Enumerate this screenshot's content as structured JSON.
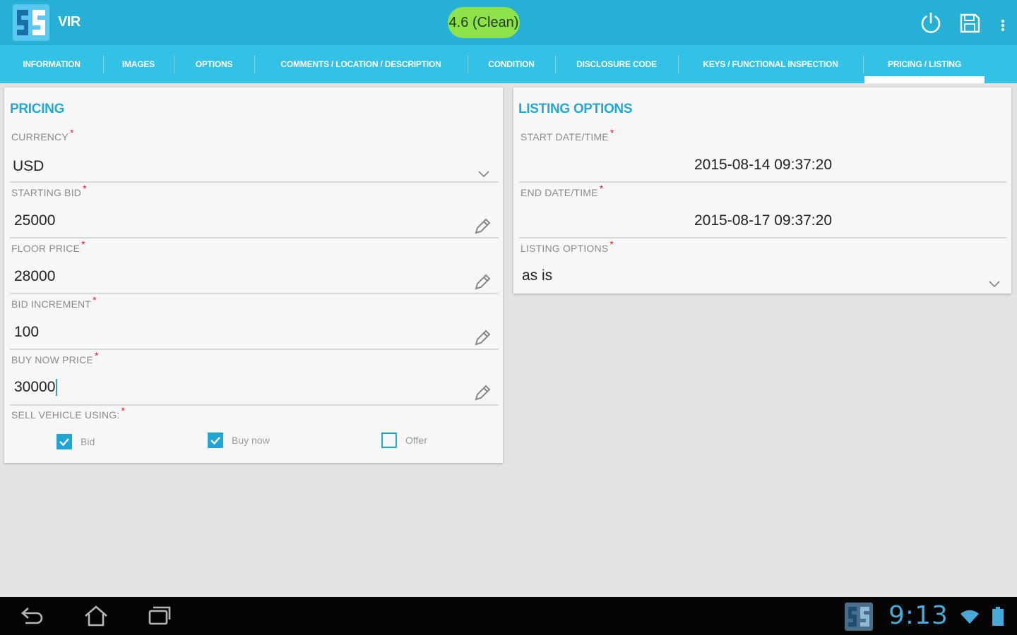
{
  "app": {
    "title": "VIR",
    "grade_badge": "4.6 (Clean)",
    "accent": "#27b0d6",
    "tab_bg": "#33c2e6",
    "badge_color": "#8fe34a"
  },
  "actions": {
    "icons": [
      "power-icon",
      "save-icon",
      "overflow-menu-icon"
    ]
  },
  "tabs": [
    {
      "label": "INFORMATION"
    },
    {
      "label": "IMAGES"
    },
    {
      "label": "OPTIONS"
    },
    {
      "label": "COMMENTS / LOCATION / DESCRIPTION"
    },
    {
      "label": "CONDITION"
    },
    {
      "label": "DISCLOSURE CODE"
    },
    {
      "label": "KEYS / FUNCTIONAL INSPECTION"
    },
    {
      "label": "PRICING / LISTING",
      "selected": true
    }
  ],
  "pricing": {
    "title": "PRICING",
    "required_mark": "*",
    "currency": {
      "label": "CURRENCY",
      "value": "USD"
    },
    "starting_bid": {
      "label": "STARTING BID",
      "value": "25000"
    },
    "floor_price": {
      "label": "FLOOR PRICE",
      "value": "28000"
    },
    "bid_increment": {
      "label": "BID INCREMENT",
      "value": "100"
    },
    "buy_now_price": {
      "label": "BUY NOW PRICE",
      "value": "30000"
    },
    "sell_vehicle_using": {
      "label": "SELL VEHICLE USING:",
      "options": [
        {
          "label": "Bid",
          "checked": true
        },
        {
          "label": "Buy now",
          "checked": true
        },
        {
          "label": "Offer",
          "checked": false
        }
      ]
    }
  },
  "listing": {
    "title": "LISTING OPTIONS",
    "required_mark": "*",
    "start": {
      "label": "START DATE/TIME",
      "value": "2015-08-14 09:37:20"
    },
    "end": {
      "label": "END DATE/TIME",
      "value": "2015-08-17 09:37:20"
    },
    "options": {
      "label": "LISTING OPTIONS",
      "value": "as is"
    }
  },
  "system_bar": {
    "clock": "9:13",
    "icons": [
      "back-icon",
      "home-icon",
      "recent-apps-icon",
      "app-notification-icon",
      "wifi-icon",
      "battery-icon"
    ]
  }
}
